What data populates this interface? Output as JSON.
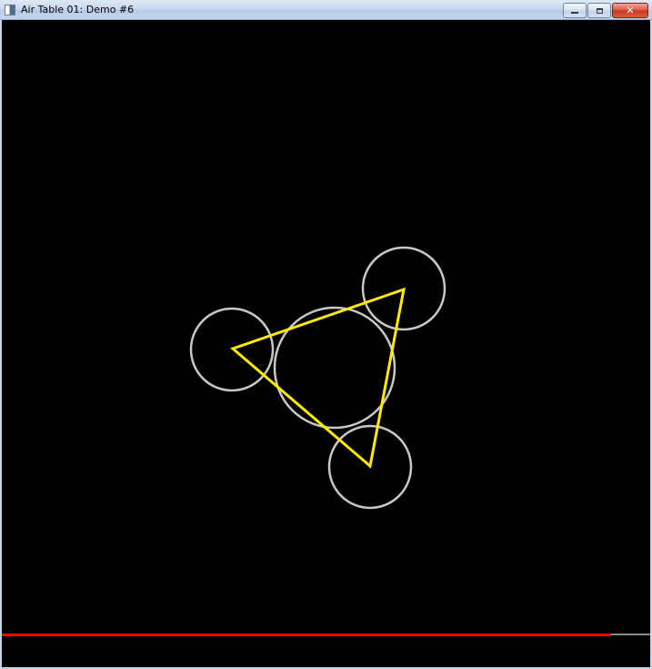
{
  "window": {
    "title": "Air Table 01: Demo #6",
    "icon": "app-window-icon",
    "controls": {
      "minimize_icon": "minimize-icon",
      "maximize_icon": "maximize-icon",
      "close_icon": "close-icon",
      "close_glyph": "✕"
    }
  },
  "scene": {
    "background": "#000000",
    "puck_color": "#c8c8c8",
    "constraint_color": "#ffea00",
    "progress_bar": {
      "color": "#ff0000",
      "track_color": "#8a8a8a",
      "fraction": 0.94
    }
  }
}
